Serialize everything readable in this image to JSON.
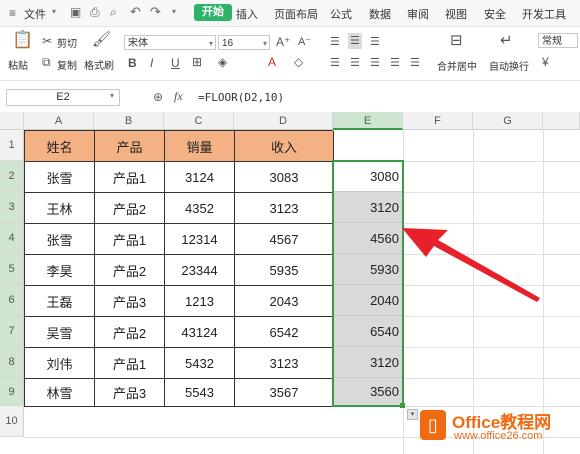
{
  "menu": {
    "file": "文件",
    "tabs": [
      "开始",
      "插入",
      "页面布局",
      "公式",
      "数据",
      "审阅",
      "视图",
      "安全",
      "开发工具"
    ]
  },
  "ribbon": {
    "paste": "粘贴",
    "cut": "剪切",
    "copy": "复制",
    "format_painter": "格式刷",
    "font_name": "宋体",
    "font_size": "16",
    "merge_center": "合并居中",
    "wrap_text": "自动换行",
    "number_format": "常规",
    "bold": "B",
    "italic": "I",
    "underline": "U"
  },
  "formula_bar": {
    "name_box": "E2",
    "fx": "fx",
    "formula": "=FLOOR(D2,10)"
  },
  "columns": [
    "A",
    "B",
    "C",
    "D",
    "E",
    "F",
    "G"
  ],
  "rows": [
    "1",
    "2",
    "3",
    "4",
    "5",
    "6",
    "7",
    "8",
    "9",
    "10"
  ],
  "table": {
    "headers": [
      "姓名",
      "产品",
      "销量",
      "收入"
    ],
    "rows": [
      [
        "张雪",
        "产品1",
        "3124",
        "3083"
      ],
      [
        "王林",
        "产品2",
        "4352",
        "3123"
      ],
      [
        "张雪",
        "产品1",
        "12314",
        "4567"
      ],
      [
        "李昊",
        "产品2",
        "23344",
        "5935"
      ],
      [
        "王磊",
        "产品3",
        "1213",
        "2043"
      ],
      [
        "吴雪",
        "产品2",
        "43124",
        "6542"
      ],
      [
        "刘伟",
        "产品1",
        "5432",
        "3123"
      ],
      [
        "林雪",
        "产品3",
        "5543",
        "3567"
      ]
    ],
    "e_values": [
      "3080",
      "3120",
      "4560",
      "5930",
      "2040",
      "6540",
      "3120",
      "3560"
    ]
  },
  "watermark": {
    "brand": "Office教程网",
    "url": "www.office26.com"
  },
  "colors": {
    "accent": "#2fb36b",
    "header_fill": "#f4b183",
    "selection_border": "#3a9a46",
    "arrow": "#e8202a",
    "logo_orange": "#f06a14"
  }
}
